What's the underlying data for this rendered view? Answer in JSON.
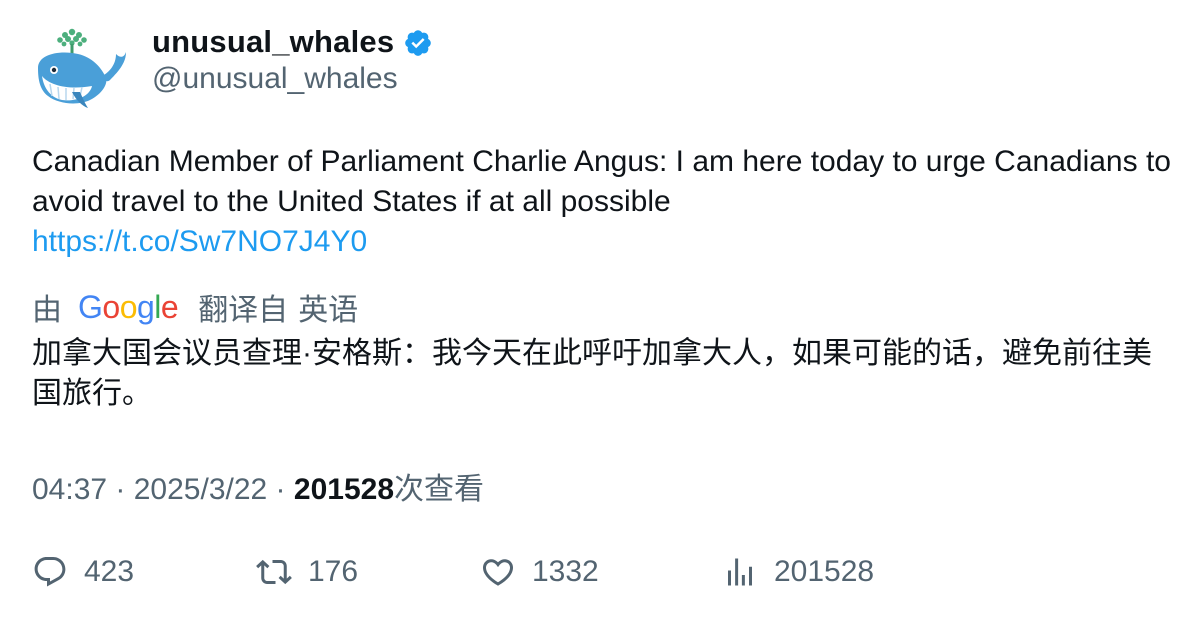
{
  "author": {
    "display_name": "unusual_whales",
    "handle": "@unusual_whales",
    "verified": true,
    "avatar_icon": "whale-avatar-icon"
  },
  "tweet": {
    "text": "Canadian Member of Parliament Charlie Angus: I am here today to urge Canadians to avoid travel to the United States if at all possible",
    "link": "https://t.co/Sw7NO7J4Y0"
  },
  "translation": {
    "prefix": "由",
    "provider_letters": [
      "G",
      "o",
      "o",
      "g",
      "l",
      "e"
    ],
    "provider_colors": [
      "#4285f4",
      "#ea4335",
      "#fbbc05",
      "#4285f4",
      "#34a853",
      "#ea4335"
    ],
    "action": "翻译自",
    "source_language": "英语",
    "text": "加拿大国会议员查理·安格斯：我今天在此呼吁加拿大人，如果可能的话，避免前往美国旅行。"
  },
  "meta": {
    "time": "04:37",
    "separator": " · ",
    "date": "2025/3/22",
    "views_count": "201528",
    "views_label": "次查看"
  },
  "actions": {
    "replies": "423",
    "retweets": "176",
    "likes": "1332",
    "views": "201528"
  },
  "colors": {
    "text_primary": "#0f1419",
    "text_secondary": "#536471",
    "link": "#1d9bf0",
    "verified": "#1d9bf0"
  }
}
